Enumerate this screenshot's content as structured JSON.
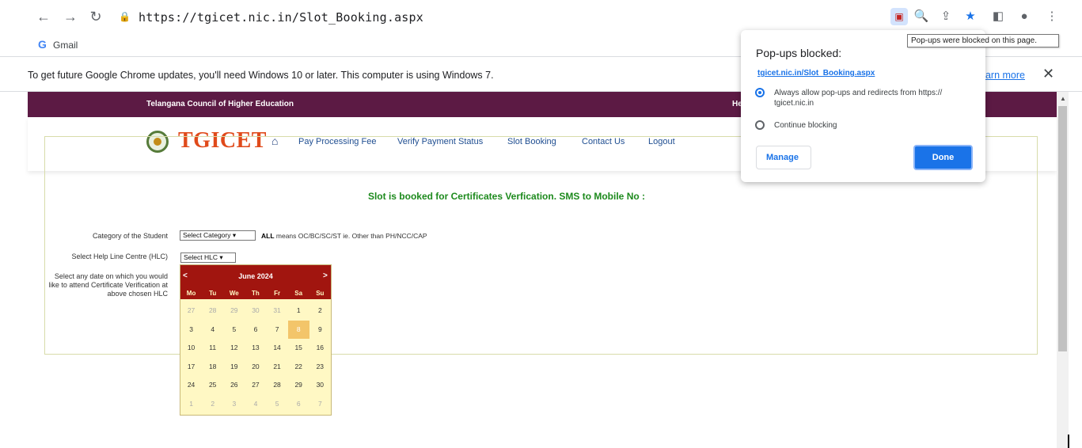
{
  "browser": {
    "url": "https://tgicet.nic.in/Slot_Booking.aspx",
    "bookmark_gmail": "Gmail",
    "gmail_glyph": "G",
    "infobar_text": "To get future Google Chrome updates, you'll need Windows 10 or later. This computer is using Windows 7.",
    "learn_more": "earn more",
    "close_glyph": "✕"
  },
  "site": {
    "council_title": "Telangana Council of Higher Education",
    "header_right_partial": "He",
    "logo_text": "TGICET",
    "nav": [
      {
        "label": "Pay Processing Fee"
      },
      {
        "label": "Verify Payment Status"
      },
      {
        "label": "Slot Booking"
      },
      {
        "label": "Contact Us"
      },
      {
        "label": "Logout"
      }
    ],
    "notice": "Slot is booked for Certificates Verfication. SMS to Mobile No :"
  },
  "form": {
    "category_label": "Category of the Student",
    "category_value": "Select Category",
    "all_note_bold": "ALL",
    "all_note_text": " means OC/BC/SC/ST ie. Other than PH/NCC/CAP",
    "hlc_label": "Select Help Line Centre (HLC)",
    "hlc_value": "Select HLC",
    "date_label": "Select any date on which you would like to attend Certificate Verification at above chosen HLC"
  },
  "calendar": {
    "title": "June 2024",
    "prev": "<",
    "next": ">",
    "days_of_week": [
      "Mo",
      "Tu",
      "We",
      "Th",
      "Fr",
      "Sa",
      "Su"
    ],
    "weeks": [
      [
        "27",
        "28",
        "29",
        "30",
        "31",
        "1",
        "2"
      ],
      [
        "3",
        "4",
        "5",
        "6",
        "7",
        "8",
        "9"
      ],
      [
        "10",
        "11",
        "12",
        "13",
        "14",
        "15",
        "16"
      ],
      [
        "17",
        "18",
        "19",
        "20",
        "21",
        "22",
        "23"
      ],
      [
        "24",
        "25",
        "26",
        "27",
        "28",
        "29",
        "30"
      ],
      [
        "1",
        "2",
        "3",
        "4",
        "5",
        "6",
        "7"
      ]
    ],
    "selected_day": "8"
  },
  "popup_bubble": {
    "title": "Pop-ups blocked:",
    "link": "tgicet.nic.in/Slot_Booking.aspx",
    "option_allow": "Always allow pop-ups and redirects from https:// tgicet.nic.in",
    "option_block": "Continue blocking",
    "manage": "Manage",
    "done": "Done",
    "tooltip": "Pop-ups were blocked on this page."
  },
  "colors": {
    "header_bar": "#5c1a44",
    "calendar_header": "#a1150f",
    "calendar_body": "#fff8c4",
    "notice_green": "#1d8a1d",
    "logo_orange": "#e04a1b",
    "chrome_blue": "#1a73e8"
  }
}
